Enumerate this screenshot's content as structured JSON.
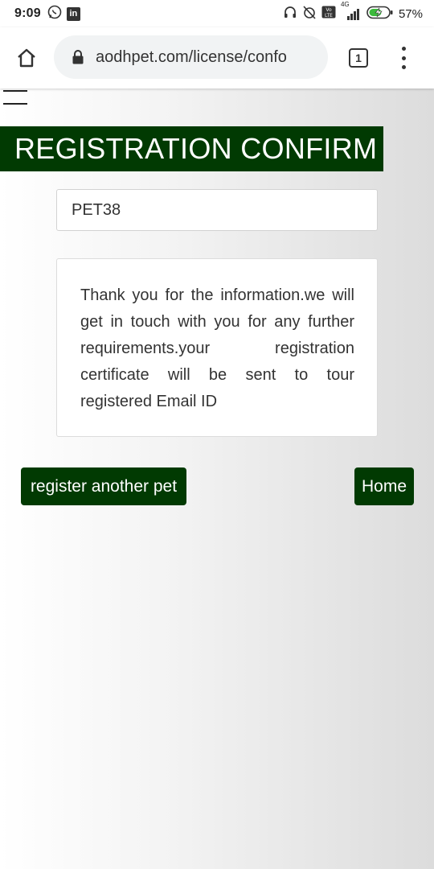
{
  "status_bar": {
    "time": "9:09",
    "battery_percent": "57%",
    "network": "4G"
  },
  "browser": {
    "url": "aodhpet.com/license/confo",
    "tab_count": "1"
  },
  "page": {
    "title": "REGISTRATION CONFIRM",
    "registration_id": "PET38",
    "message": "Thank you for the information.we will get in touch with you for any further requirements.your registration certificate will be sent to tour registered Email ID",
    "buttons": {
      "register_another": "register another pet",
      "home": "Home"
    }
  },
  "colors": {
    "brand_green": "#013a02",
    "card_bg": "#ffffff"
  }
}
